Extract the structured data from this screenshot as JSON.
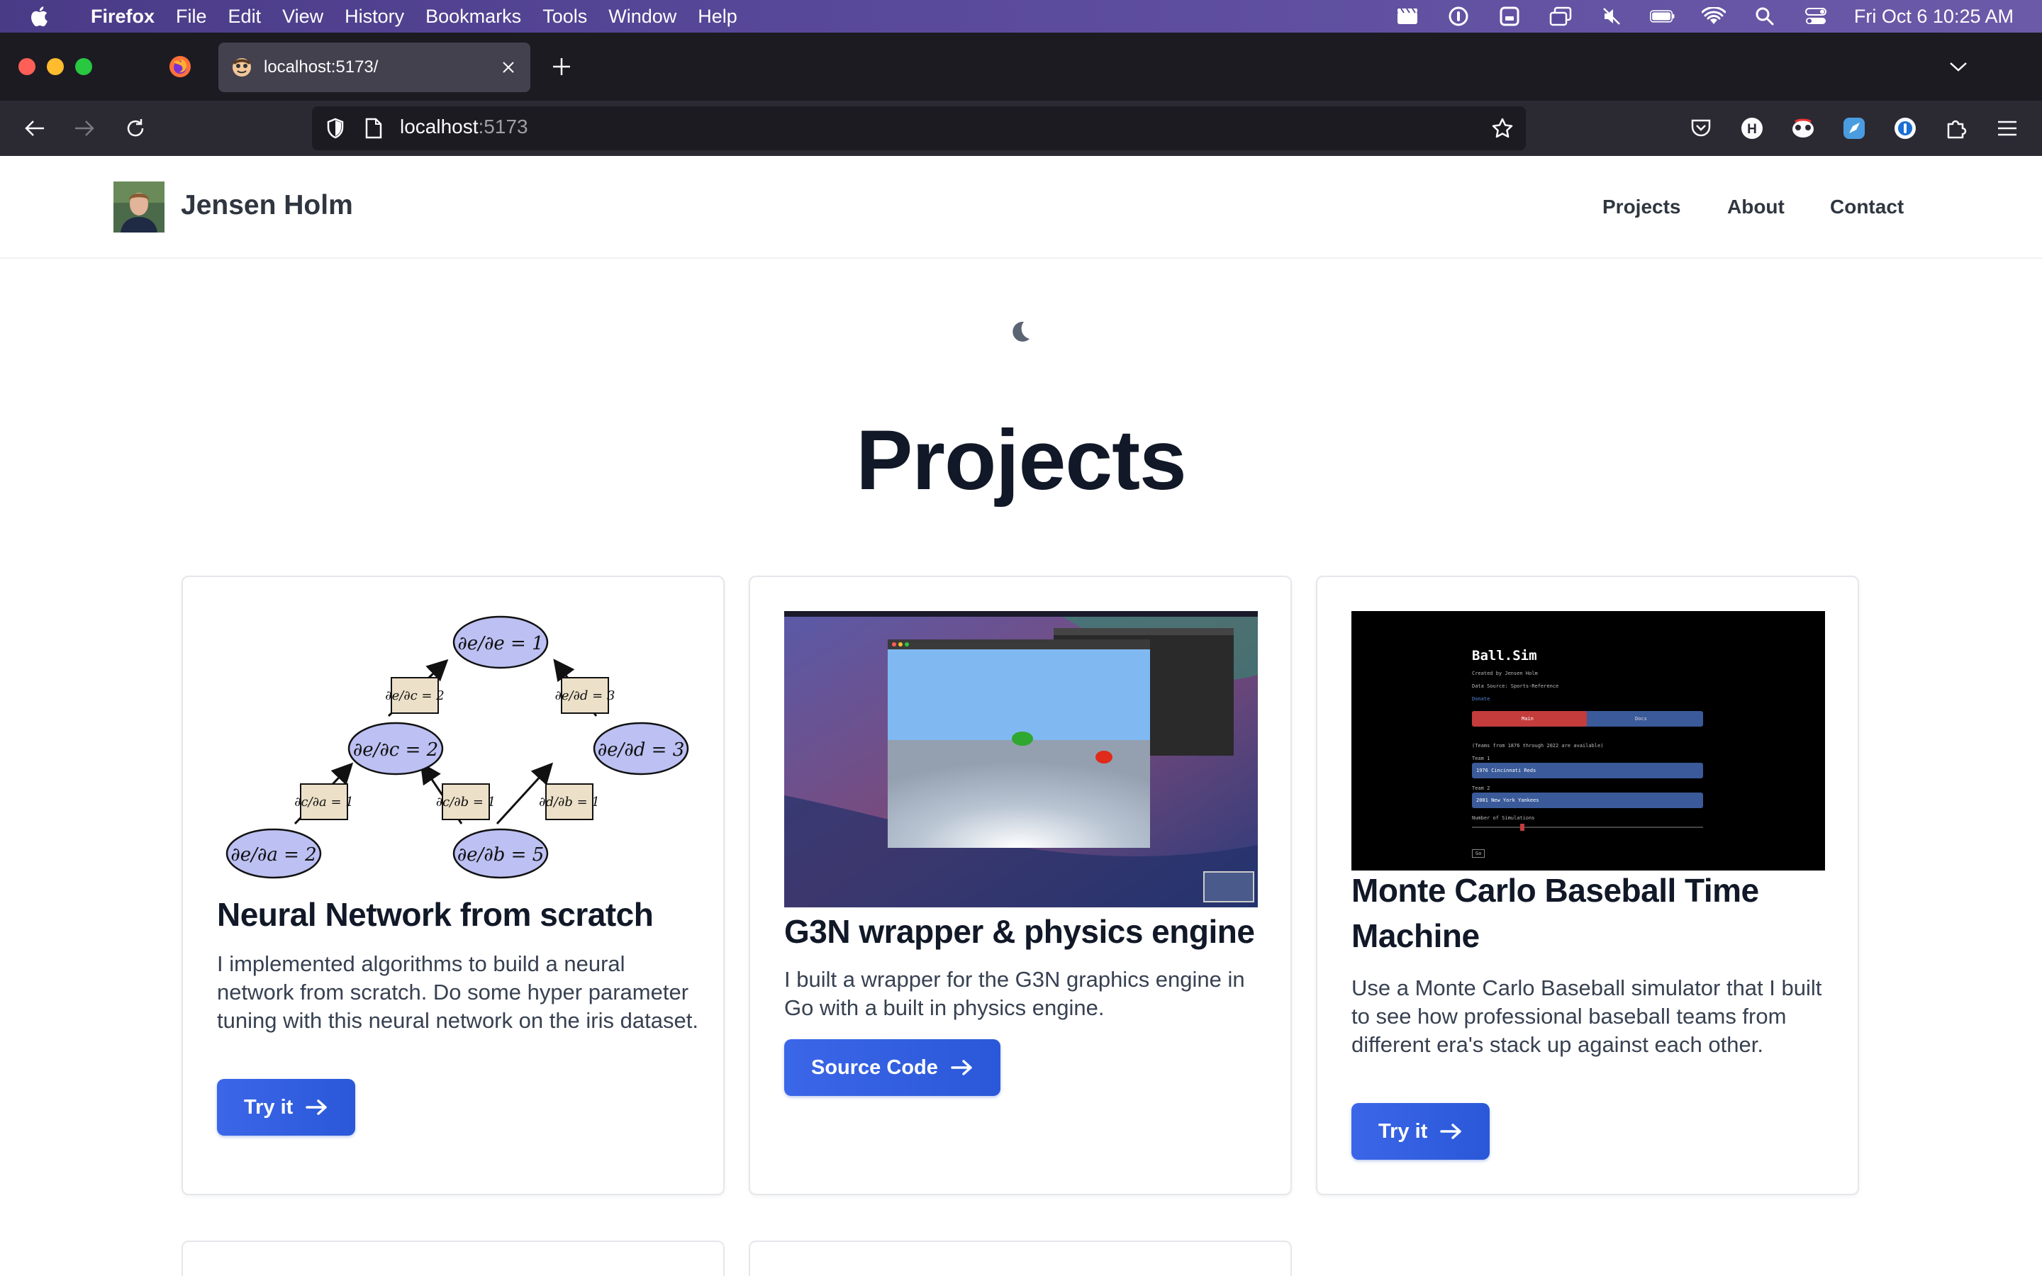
{
  "menubar": {
    "app": "Firefox",
    "items": [
      "File",
      "Edit",
      "View",
      "History",
      "Bookmarks",
      "Tools",
      "Window",
      "Help"
    ],
    "clock": "Fri Oct 6  10:25 AM"
  },
  "browser": {
    "tab_title": "localhost:5173/",
    "url_host": "localhost",
    "url_port": ":5173"
  },
  "site": {
    "name": "Jensen Holm",
    "nav": [
      "Projects",
      "About",
      "Contact"
    ]
  },
  "page": {
    "heading": "Projects"
  },
  "cards": [
    {
      "title": "Neural Network from scratch",
      "description": "I implemented algorithms to build a neural network from scratch. Do some hyper parameter tuning with this neural network on the iris dataset.",
      "button": "Try it"
    },
    {
      "title": "G3N wrapper & physics engine",
      "description": "I built a wrapper for the G3N graphics engine in Go with a built in physics engine.",
      "button": "Source Code"
    },
    {
      "title": "Monte Carlo Baseball Time Machine",
      "description": "Use a Monte Carlo Baseball simulator that I built to see how professional baseball teams from different era's stack up against each other.",
      "button": "Try it"
    }
  ],
  "graph": {
    "nodes": [
      "∂e/∂e = 1",
      "∂e/∂c = 2",
      "∂e/∂d = 3",
      "∂e/∂a = 2",
      "∂e/∂b = 5"
    ],
    "edges": [
      "∂e/∂c = 2",
      "∂e/∂d = 3",
      "∂c/∂a = 1",
      "∂c/∂b = 1",
      "∂d/∂b = 1"
    ]
  },
  "ballsim": {
    "title": "Ball.Sim",
    "created_by": "Created by Jensen Holm",
    "data_source": "Data Source: Sports-Reference",
    "donate": "Donate",
    "tab_main": "Main",
    "tab_docs": "Docs",
    "teams_note": "(Teams from 1876 through 2022 are available)",
    "team1_label": "Team 1",
    "team1": "1976 Cincinnati Reds",
    "team2_label": "Team 2",
    "team2": "2001 New York Yankees",
    "sims_label": "Number of Simulations",
    "go": "Go"
  },
  "colors": {
    "accent": "#2f5fe0",
    "heading": "#111827",
    "text": "#374151"
  }
}
